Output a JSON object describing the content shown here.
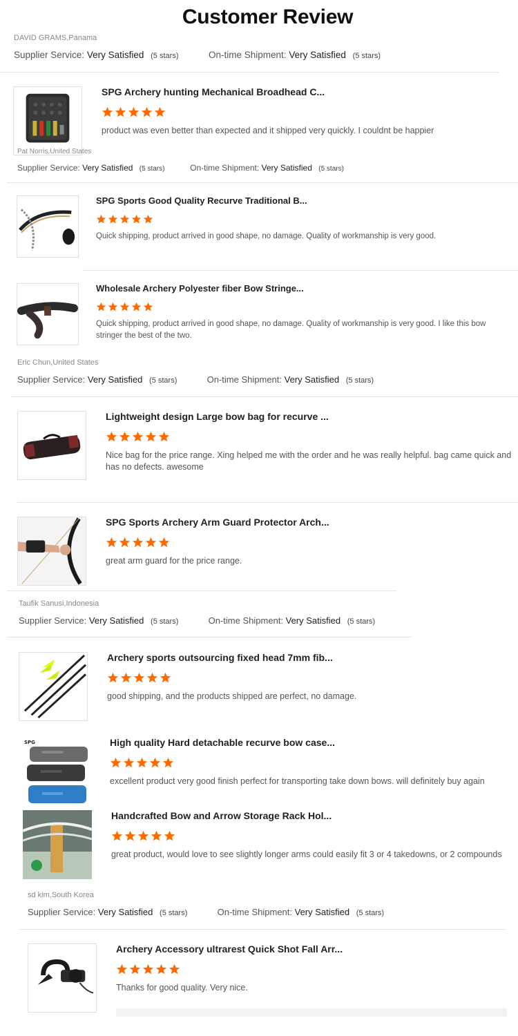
{
  "page": {
    "title": "Customer Review"
  },
  "labels": {
    "supplier_service": "Supplier Service:",
    "ontime_shipment": "On-time Shipment:",
    "very_satisfied": "Very Satisfied",
    "five_stars": "(5 stars)"
  },
  "colors": {
    "star": "#ff6a00",
    "divider": "#e3e3e3"
  },
  "reviewers": [
    {
      "name": "DAVID GRAMS,Panama"
    },
    {
      "name": "Pat Norris,United States"
    },
    {
      "name": "Eric Chun,United States"
    },
    {
      "name": "Taufik Sanusi,Indonesia"
    },
    {
      "name": "sd kim,South Korea"
    }
  ],
  "products": [
    {
      "title": "SPG Archery hunting Mechanical Broadhead C...",
      "rating": 5,
      "icon": "broadhead-case-image",
      "review": "product was even better than expected and it shipped very quickly. I couldnt be happier"
    },
    {
      "title": "SPG Sports Good Quality Recurve Traditional B...",
      "rating": 5,
      "icon": "recurve-bow-image",
      "review": "Quick shipping, product arrived in good shape, no damage.  Quality of workmanship is very good."
    },
    {
      "title": "Wholesale Archery Polyester fiber Bow Stringe...",
      "rating": 5,
      "icon": "bow-stringer-image",
      "review": "Quick shipping, product arrived in good shape, no damage.  Quality of workmanship is very good.    I like this bow stringer the best of the two."
    },
    {
      "title": "Lightweight design Large bow bag for recurve ...",
      "rating": 5,
      "icon": "bow-bag-image",
      "review": "Nice bag for the price range. Xing helped me with the order and he was really helpful. bag came quick and has no defects. awesome"
    },
    {
      "title": "SPG Sports Archery Arm Guard Protector Arch...",
      "rating": 5,
      "icon": "arm-guard-image",
      "review": "great arm guard for the price range."
    },
    {
      "title": "Archery sports outsourcing fixed head 7mm fib...",
      "rating": 5,
      "icon": "arrows-image",
      "review": "good shipping, and the products shipped are perfect, no damage."
    },
    {
      "title": "High quality Hard detachable recurve bow case...",
      "rating": 5,
      "icon": "bow-case-image",
      "review": "excellent product very good finish perfect for transporting take down bows. will definitely buy again"
    },
    {
      "title": "Handcrafted Bow and Arrow Storage Rack Hol...",
      "rating": 5,
      "icon": "storage-rack-image",
      "review": "great product, would love to see slightly longer arms could easily fit 3 or 4 takedowns, or 2 compounds"
    },
    {
      "title": "Archery Accessory ultrarest Quick Shot Fall Arr...",
      "rating": 5,
      "icon": "arrow-rest-image",
      "review": "Thanks for good quality. Very nice."
    }
  ]
}
